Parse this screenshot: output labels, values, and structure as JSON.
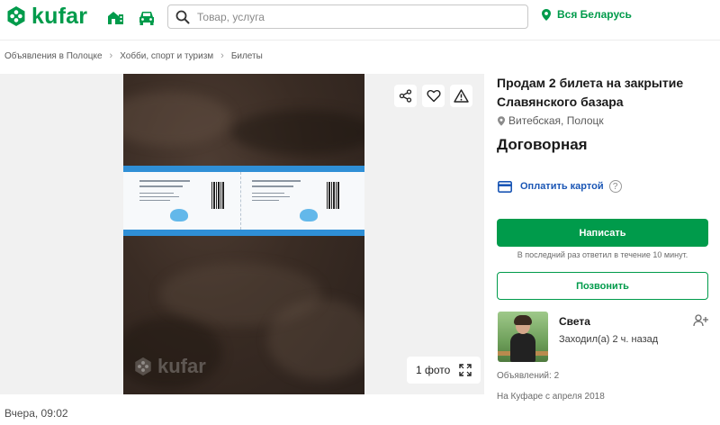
{
  "header": {
    "logo_text": "kufar",
    "search_placeholder": "Товар, услуга",
    "region_label": "Вся Беларусь",
    "icons": [
      "kufar-logo-icon",
      "real-estate-icon",
      "car-icon",
      "search-icon",
      "location-pin-icon"
    ]
  },
  "breadcrumb": {
    "items": [
      "Объявления в Полоцке",
      "Хобби, спорт и туризм",
      "Билеты"
    ]
  },
  "gallery": {
    "photo_count_label": "1 фото",
    "watermark_text": "kufar",
    "actions": [
      "share-icon",
      "heart-icon",
      "warning-icon",
      "fullscreen-icon"
    ]
  },
  "ad": {
    "title": "Продам 2 билета на закрытие Славянского базара",
    "location": "Витебская, Полоцк",
    "price": "Договорная",
    "pay_by_card_label": "Оплатить картой",
    "help_mark": "?",
    "write_button": "Написать",
    "reply_note": "В последний раз ответил в течение 10 минут.",
    "call_button": "Позвонить",
    "date": "Вчера, 09:02"
  },
  "seller": {
    "name": "Света",
    "last_seen": "Заходил(а) 2 ч. назад",
    "ads_count": "Объявлений: 2",
    "member_since": "На Куфаре с апреля 2018"
  },
  "colors": {
    "brand_green": "#009b4b",
    "link_blue": "#1a56b5",
    "gallery_bg": "#f1f1f1"
  }
}
